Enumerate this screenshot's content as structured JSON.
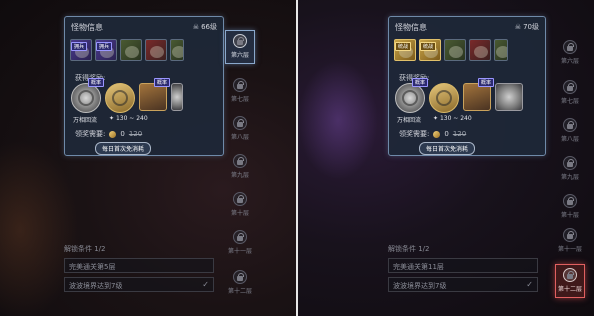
{
  "left": {
    "card": {
      "title": "怪物信息",
      "level": "66级",
      "monsters": [
        {
          "tag": "拥兵",
          "style": "purple"
        },
        {
          "tag": "拥兵",
          "style": "purple"
        },
        {
          "tag": "",
          "style": "green"
        },
        {
          "tag": "",
          "style": "red"
        },
        {
          "tag": "",
          "style": "green"
        }
      ],
      "rewards_label": "获得奖励:",
      "reward_items": [
        {
          "caption": "万相回流",
          "badge": "概率"
        },
        {
          "caption": "",
          "badge": ""
        },
        {
          "caption": "",
          "badge": "概率"
        },
        {
          "caption": "",
          "badge": ""
        }
      ],
      "range_text": "130 ~ 240",
      "claim_label": "领奖需要:",
      "claim_value": "0",
      "claim_old": "120",
      "free_button": "每日首次免消耗"
    },
    "floors": [
      "第六层",
      "第七层",
      "第八层",
      "第九层",
      "第十层",
      "第十一层",
      "第十二层"
    ],
    "unlock_title": "解锁条件 1/2",
    "conditions": [
      "完美通关第5层",
      "波波境界达到7级"
    ]
  },
  "right": {
    "card": {
      "title": "怪物信息",
      "level": "70级",
      "monsters": [
        {
          "tag": "统战",
          "style": "gold"
        },
        {
          "tag": "统战",
          "style": "gold"
        },
        {
          "tag": "",
          "style": "green"
        },
        {
          "tag": "",
          "style": "red"
        },
        {
          "tag": "",
          "style": "green"
        }
      ],
      "rewards_label": "获得奖励:",
      "reward_items": [
        {
          "caption": "万相回流",
          "badge": "概率"
        },
        {
          "caption": "",
          "badge": ""
        },
        {
          "caption": "",
          "badge": "概率"
        },
        {
          "caption": "",
          "badge": ""
        }
      ],
      "range_text": "130 ~ 240",
      "claim_label": "领奖需要:",
      "claim_value": "0",
      "claim_old": "120",
      "free_button": "每日首次免消耗"
    },
    "floors": [
      "第六层",
      "第七层",
      "第八层",
      "第九层",
      "第十层",
      "第十一层",
      "第十二层"
    ],
    "unlock_title": "解锁条件 1/2",
    "conditions": [
      "完美通关第11层",
      "波波境界达到7级"
    ]
  }
}
